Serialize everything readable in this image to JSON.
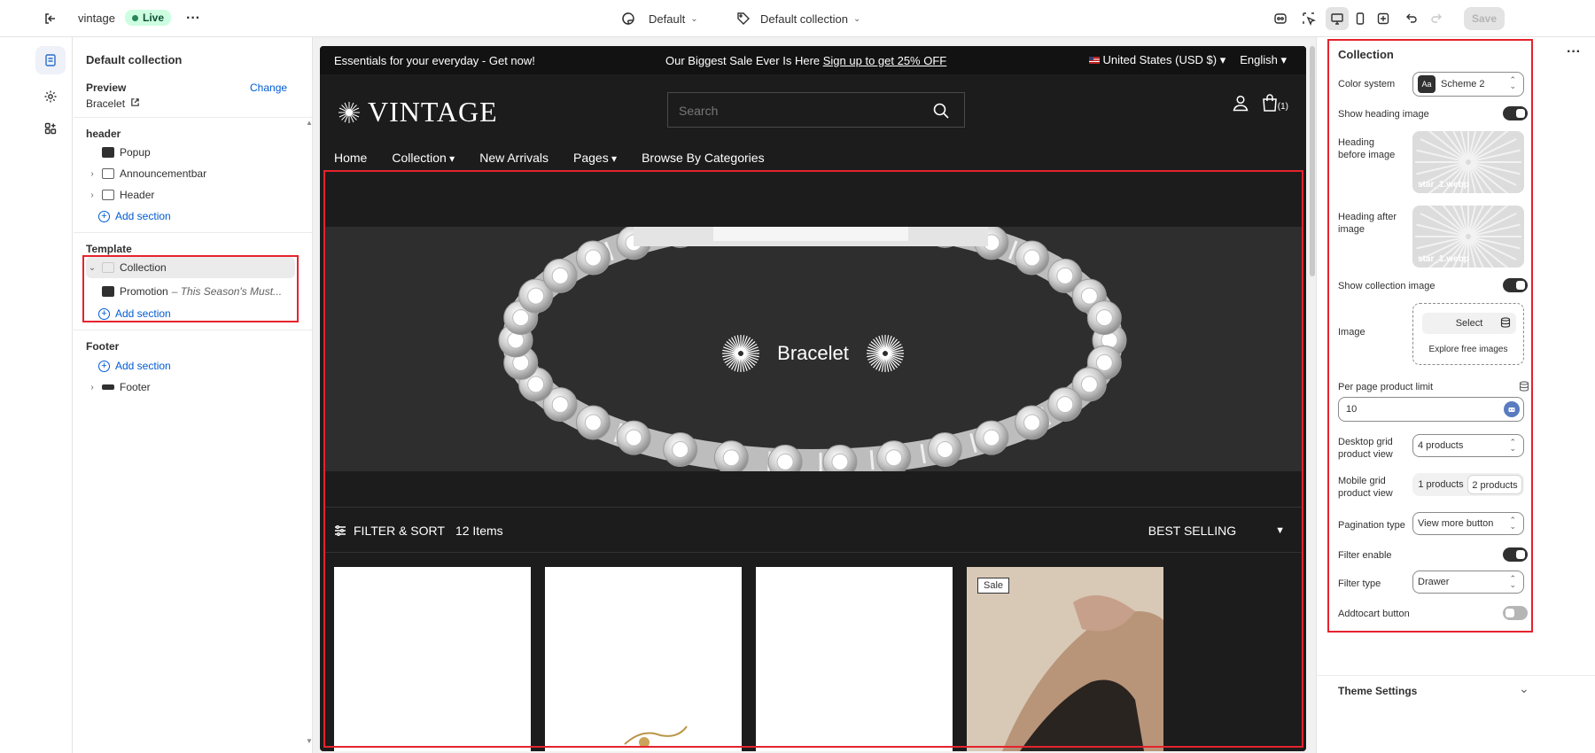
{
  "topbar": {
    "store_name": "vintage",
    "live_label": "Live",
    "theme_selector": "Default",
    "template_selector": "Default collection",
    "save_label": "Save"
  },
  "sidebar": {
    "title": "Default collection",
    "preview_label": "Preview",
    "change_link": "Change",
    "preview_value": "Bracelet",
    "header_group": "header",
    "header_items": [
      "Popup",
      "Announcementbar",
      "Header"
    ],
    "add_section": "Add section",
    "template_group": "Template",
    "collection_item": "Collection",
    "promotion_item": "Promotion",
    "promotion_sub": "– This Season's Must...",
    "footer_group": "Footer",
    "footer_item": "Footer"
  },
  "store": {
    "announcement_left": "Essentials for your everyday - Get now!",
    "announcement_center_a": "Our Biggest Sale Ever Is Here ",
    "announcement_center_b": "Sign up to get 25% OFF",
    "currency": "United States (USD $)",
    "language": "English",
    "logo_text": "VINTAGE",
    "search_placeholder": "Search",
    "cart_count": "(1)",
    "nav": [
      "Home",
      "Collection",
      "New Arrivals",
      "Pages",
      "Browse By Categories"
    ],
    "banner_title": "Bracelet",
    "filter_label": "FILTER & SORT",
    "items_count": "12 Items",
    "sort_label": "BEST SELLING",
    "sale_badge": "Sale"
  },
  "settings": {
    "title": "Collection",
    "color_system_label": "Color system",
    "color_system_value": "Scheme 2",
    "color_chip": "Aa",
    "show_heading_image_label": "Show heading image",
    "heading_before_label": "Heading before image",
    "heading_before_file": "star_1.webp",
    "heading_after_label": "Heading after image",
    "heading_after_file": "star_1.webp",
    "show_collection_image_label": "Show collection image",
    "image_label": "Image",
    "select_label": "Select",
    "explore_label": "Explore free images",
    "per_page_label": "Per page product limit",
    "per_page_value": "10",
    "desktop_grid_label": "Desktop grid product view",
    "desktop_grid_value": "4 products",
    "mobile_grid_label": "Mobile grid product view",
    "mobile_options": [
      "1 products",
      "2 products"
    ],
    "pagination_label": "Pagination type",
    "pagination_value": "View more button",
    "filter_enable_label": "Filter enable",
    "filter_type_label": "Filter type",
    "filter_type_value": "Drawer",
    "addtocart_label": "Addtocart button",
    "theme_settings_label": "Theme Settings"
  },
  "colors": {
    "accent_blue": "#005bd3",
    "annotation_red": "#e5232d",
    "live_green": "#cdfee1"
  }
}
